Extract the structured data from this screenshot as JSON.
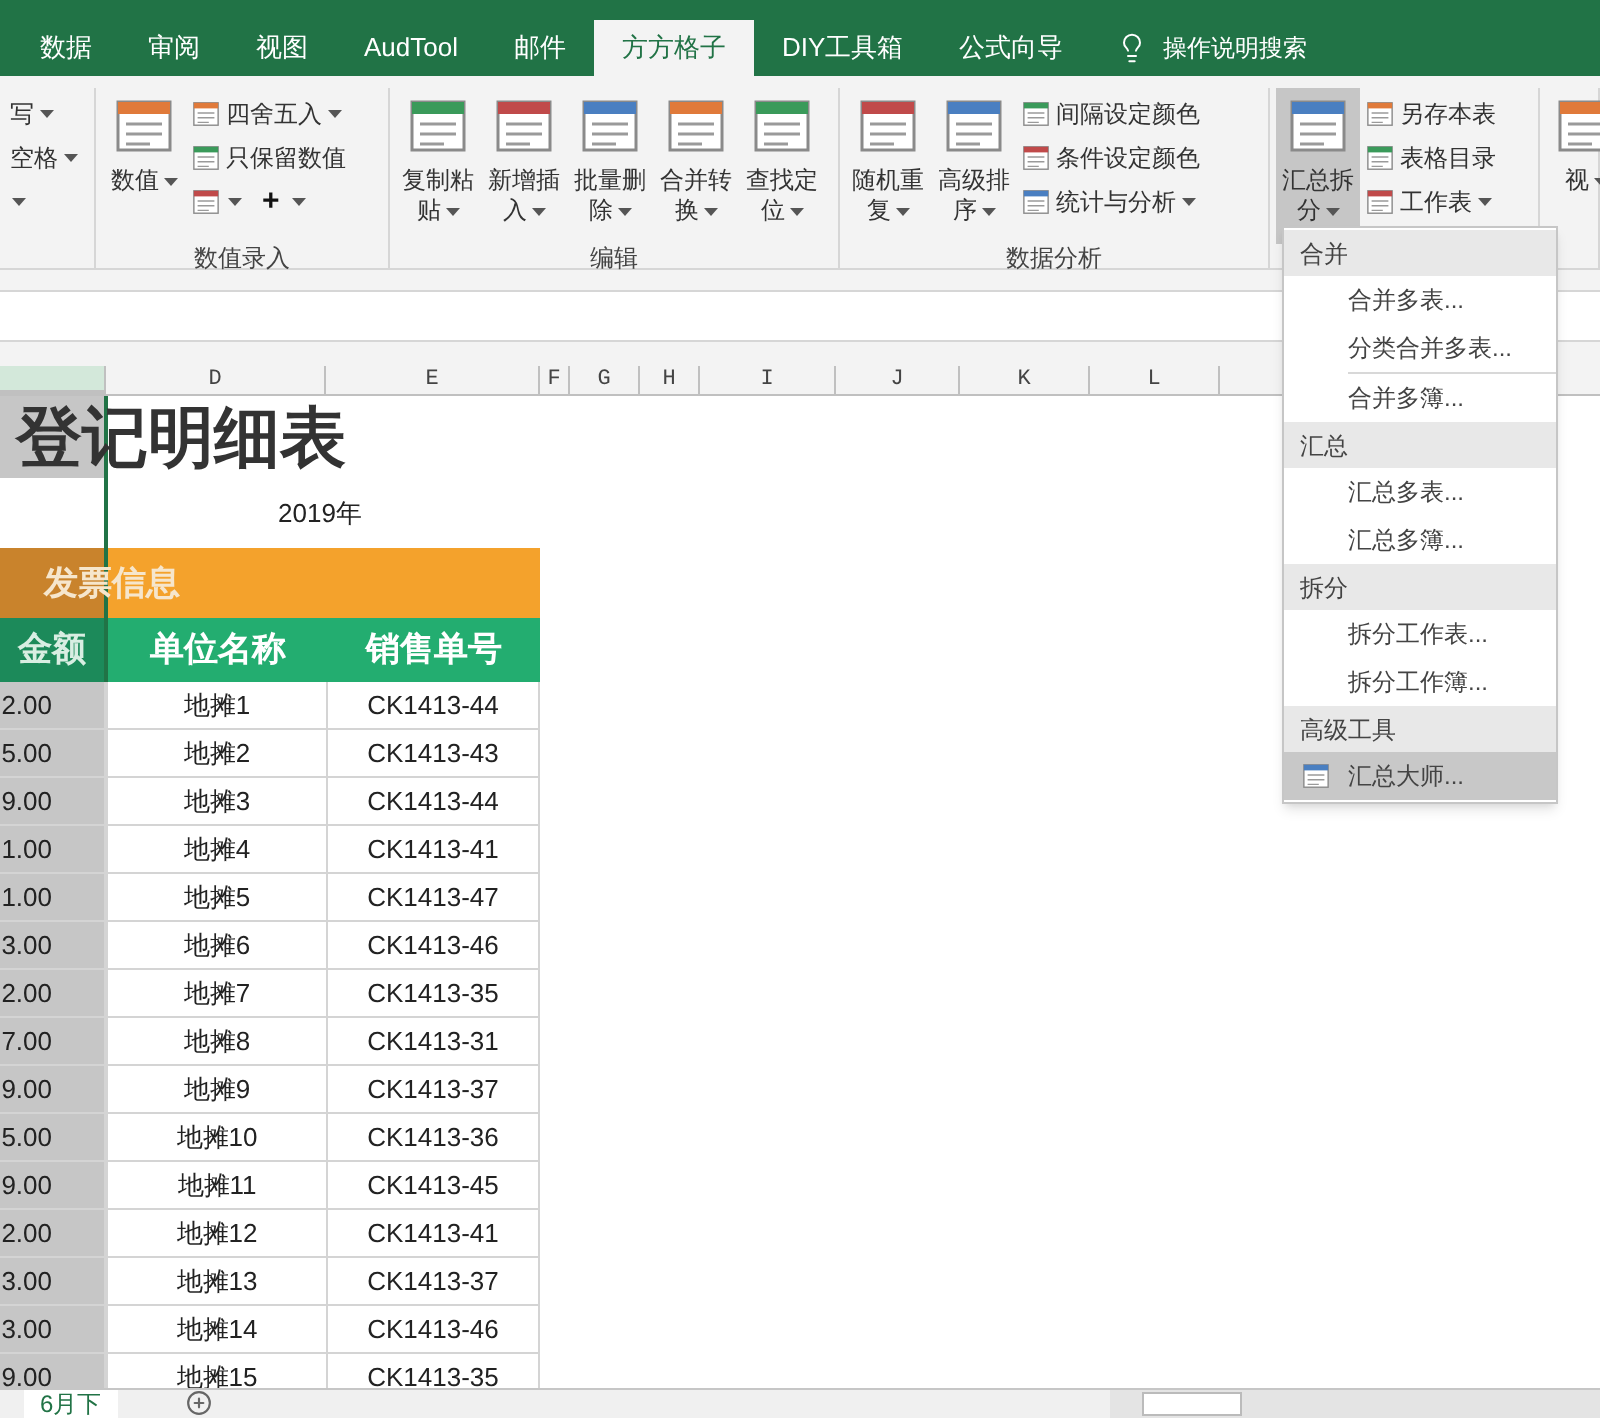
{
  "ribbon_tabs": [
    {
      "label": "数据",
      "selected": false
    },
    {
      "label": "审阅",
      "selected": false
    },
    {
      "label": "视图",
      "selected": false
    },
    {
      "label": "AudTool",
      "selected": false
    },
    {
      "label": "邮件",
      "selected": false
    },
    {
      "label": "方方格子",
      "selected": true
    },
    {
      "label": "DIY工具箱",
      "selected": false
    },
    {
      "label": "公式向导",
      "selected": false
    }
  ],
  "tell_me": "操作说明搜索",
  "ribbon_groups": [
    {
      "blocks": [
        {
          "kind": "stack",
          "lines": [
            [
              {
                "kind": "text",
                "label": "写",
                "dropdown": true
              }
            ],
            [
              {
                "kind": "text",
                "label": "空格",
                "dropdown": true
              }
            ],
            [
              {
                "kind": "caret",
                "dropdown": true
              }
            ]
          ]
        }
      ]
    },
    {
      "label": "数值录入",
      "blocks": [
        {
          "kind": "large",
          "label": "数值",
          "dropdown": true,
          "pressed": false
        },
        {
          "kind": "stack",
          "lines": [
            [
              {
                "kind": "small",
                "label": "四舍五入",
                "dropdown": true
              }
            ],
            [
              {
                "kind": "small",
                "label": "只保留数值",
                "dropdown": false
              }
            ],
            [
              {
                "kind": "icon",
                "dropdown": true
              },
              {
                "kind": "symbol",
                "label": "+",
                "dropdown": true
              }
            ]
          ]
        }
      ]
    },
    {
      "label": "编辑",
      "blocks": [
        {
          "kind": "large",
          "label": "复制粘贴",
          "dropdown": true,
          "pressed": false
        },
        {
          "kind": "large",
          "label": "新增插入",
          "dropdown": true,
          "pressed": false
        },
        {
          "kind": "large",
          "label": "批量删除",
          "dropdown": true,
          "pressed": false
        },
        {
          "kind": "large",
          "label": "合并转换",
          "dropdown": true,
          "pressed": false
        },
        {
          "kind": "large",
          "label": "查找定位",
          "dropdown": true,
          "pressed": false
        }
      ]
    },
    {
      "label": "数据分析",
      "blocks": [
        {
          "kind": "large",
          "label": "随机重复",
          "dropdown": true,
          "pressed": false
        },
        {
          "kind": "large",
          "label": "高级排序",
          "dropdown": true,
          "pressed": false
        },
        {
          "kind": "stack",
          "lines": [
            [
              {
                "kind": "small",
                "label": "间隔设定颜色",
                "dropdown": false
              }
            ],
            [
              {
                "kind": "small",
                "label": "条件设定颜色",
                "dropdown": false
              }
            ],
            [
              {
                "kind": "small",
                "label": "统计与分析",
                "dropdown": true
              }
            ]
          ]
        }
      ]
    },
    {
      "blocks": [
        {
          "kind": "large",
          "label": "汇总拆分",
          "dropdown": true,
          "pressed": true
        },
        {
          "kind": "stack",
          "lines": [
            [
              {
                "kind": "small",
                "label": "另存本表",
                "dropdown": false
              }
            ],
            [
              {
                "kind": "small",
                "label": "表格目录",
                "dropdown": false
              }
            ],
            [
              {
                "kind": "small",
                "label": "工作表",
                "dropdown": true
              }
            ]
          ]
        }
      ]
    },
    {
      "blocks": [
        {
          "kind": "large",
          "label": "视",
          "dropdown": true,
          "pressed": false
        }
      ]
    }
  ],
  "sheet": {
    "columns": [
      "",
      "D",
      "E",
      "F",
      "G",
      "H",
      "I",
      "J",
      "K",
      "L"
    ],
    "first_column_selected": true,
    "title": "登记明细表",
    "year": "2019年",
    "section_header": "发票信息",
    "headers": [
      "金额",
      "单位名称",
      "销售单号"
    ],
    "rows": [
      [
        "2.00",
        "地摊1",
        "CK1413-44"
      ],
      [
        "5.00",
        "地摊2",
        "CK1413-43"
      ],
      [
        "9.00",
        "地摊3",
        "CK1413-44"
      ],
      [
        "1.00",
        "地摊4",
        "CK1413-41"
      ],
      [
        "1.00",
        "地摊5",
        "CK1413-47"
      ],
      [
        "3.00",
        "地摊6",
        "CK1413-46"
      ],
      [
        "2.00",
        "地摊7",
        "CK1413-35"
      ],
      [
        "7.00",
        "地摊8",
        "CK1413-31"
      ],
      [
        "9.00",
        "地摊9",
        "CK1413-37"
      ],
      [
        "5.00",
        "地摊10",
        "CK1413-36"
      ],
      [
        "9.00",
        "地摊11",
        "CK1413-45"
      ],
      [
        "2.00",
        "地摊12",
        "CK1413-41"
      ],
      [
        "3.00",
        "地摊13",
        "CK1413-37"
      ],
      [
        "3.00",
        "地摊14",
        "CK1413-46"
      ],
      [
        "9.00",
        "地摊15",
        "CK1413-35"
      ]
    ]
  },
  "sheet_tabs": [
    {
      "label": "6月下",
      "selected": true
    }
  ],
  "menu": {
    "sections": [
      {
        "title": "合并",
        "items": [
          {
            "label": "合并多表...",
            "selected": false,
            "divider_before": false
          },
          {
            "label": "分类合并多表...",
            "selected": false,
            "divider_before": false
          },
          {
            "label": "合并多簿...",
            "selected": false,
            "divider_before": true
          }
        ]
      },
      {
        "title": "汇总",
        "items": [
          {
            "label": "汇总多表...",
            "selected": false,
            "divider_before": false
          },
          {
            "label": "汇总多簿...",
            "selected": false,
            "divider_before": false
          }
        ]
      },
      {
        "title": "拆分",
        "items": [
          {
            "label": "拆分工作表...",
            "selected": false,
            "divider_before": false
          },
          {
            "label": "拆分工作簿...",
            "selected": false,
            "divider_before": false
          }
        ]
      },
      {
        "title": "高级工具",
        "items": [
          {
            "label": "汇总大师...",
            "selected": true,
            "divider_before": false
          }
        ]
      }
    ]
  }
}
